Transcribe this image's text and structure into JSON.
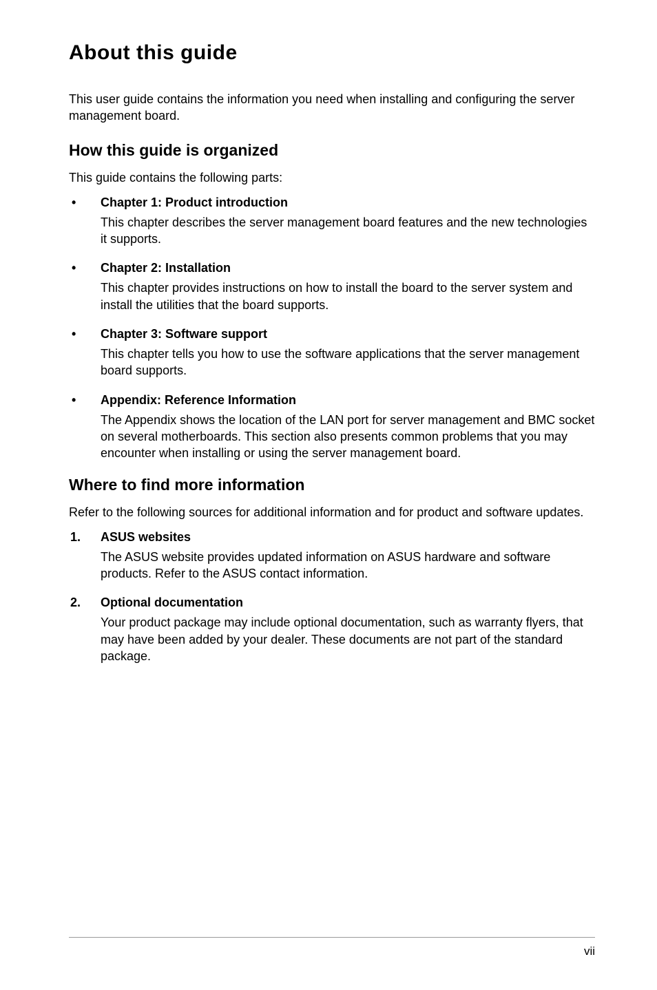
{
  "title": "About this guide",
  "intro": "This user guide contains the information you need when installing and configuring the server management board.",
  "section1": {
    "heading": "How this guide is organized",
    "intro": "This guide contains the following parts:",
    "items": [
      {
        "marker": "•",
        "title": "Chapter 1: Product introduction",
        "body": "This chapter describes the server management board features and the new technologies it supports."
      },
      {
        "marker": "•",
        "title": "Chapter 2: Installation",
        "body": "This chapter provides instructions on how to install the board to the server system and install the utilities that the board supports."
      },
      {
        "marker": "•",
        "title": "Chapter 3: Software support",
        "body": "This chapter tells you how to use the software applications that the server management board supports."
      },
      {
        "marker": "•",
        "title": "Appendix: Reference Information",
        "body": "The Appendix shows the location of the LAN port for server management and BMC socket on several motherboards. This section also presents common problems that you may encounter when installing or using the server management board."
      }
    ]
  },
  "section2": {
    "heading": "Where to find more information",
    "intro": "Refer to the following sources for additional information and for product and software updates.",
    "items": [
      {
        "marker": "1.",
        "title": "ASUS websites",
        "body": "The ASUS website provides updated information on ASUS hardware and software products. Refer to the ASUS contact information."
      },
      {
        "marker": "2.",
        "title": "Optional documentation",
        "body": "Your product package may include optional documentation, such as warranty flyers, that may have been added by your dealer. These documents are not part of the standard package."
      }
    ]
  },
  "page_number": "vii"
}
